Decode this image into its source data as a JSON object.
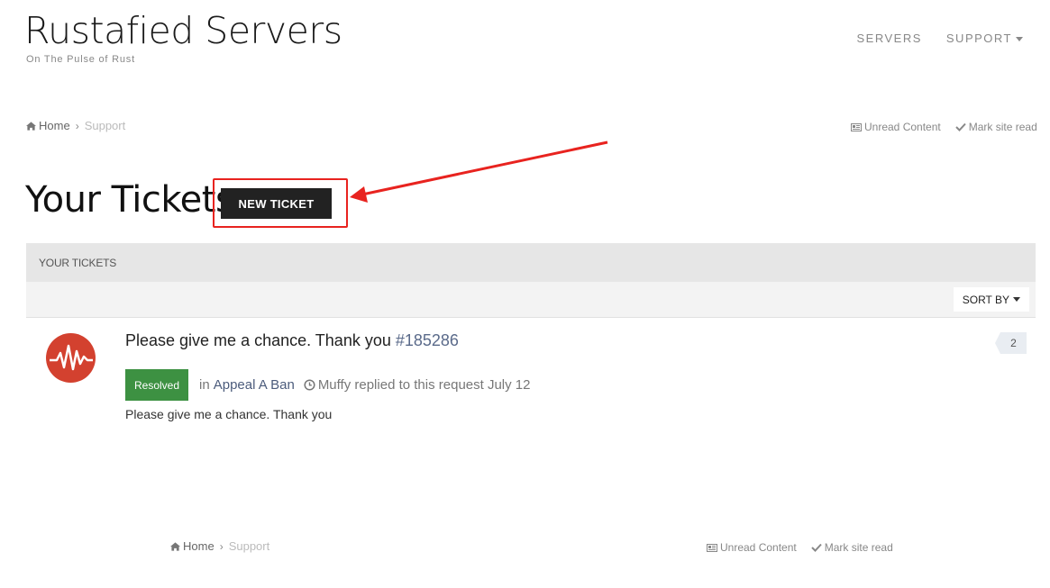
{
  "site": {
    "title": "Rustafied Servers",
    "tagline": "On The Pulse of Rust"
  },
  "nav": {
    "servers": "SERVERS",
    "support": "SUPPORT"
  },
  "breadcrumb": {
    "home": "Home",
    "current": "Support"
  },
  "utility": {
    "unread": "Unread Content",
    "mark_read": "Mark site read"
  },
  "page": {
    "title": "Your Tickets",
    "new_ticket": "NEW TICKET"
  },
  "list": {
    "header": "YOUR TICKETS",
    "sort_label": "SORT BY"
  },
  "tickets": [
    {
      "title": "Please give me a chance. Thank you",
      "id": "#185286",
      "status": "Resolved",
      "status_color": "#3d9142",
      "in_label": "in",
      "category": "Appeal A Ban",
      "activity": "Muffy replied to this request July 12",
      "snippet": "Please give me a chance. Thank you",
      "replies": "2"
    }
  ],
  "colors": {
    "annotation": "#e8231f",
    "button_bg": "#222222",
    "avatar_bg": "#d3412f"
  }
}
